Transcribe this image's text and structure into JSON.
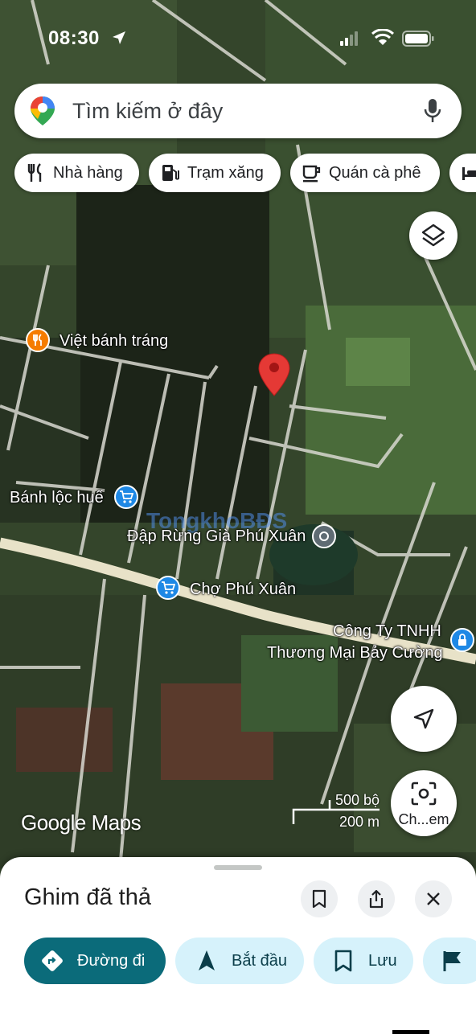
{
  "status_bar": {
    "time": "08:30"
  },
  "search": {
    "placeholder": "Tìm kiếm ở đây"
  },
  "chips": [
    {
      "label": "Nhà hàng",
      "icon": "restaurant-icon"
    },
    {
      "label": "Trạm xăng",
      "icon": "gas-station-icon"
    },
    {
      "label": "Quán cà phê",
      "icon": "coffee-icon"
    },
    {
      "label": "",
      "icon": "hotel-icon"
    }
  ],
  "map": {
    "places": {
      "viet_banh_trang": "Việt bánh tráng",
      "banh_loc_hue": "Bánh lộc huế",
      "dap_rung_gia": "Đập Rừng Già Phú Xuân",
      "cho_phu_xuan": "Chợ Phú Xuân",
      "cong_ty_line1": "Công Ty TNHH",
      "cong_ty_line2": "Thương Mại Bảy Cường"
    },
    "watermark": "TongkhoBĐS",
    "attribution": "Google Maps",
    "scale": {
      "imperial": "500 bộ",
      "metric": "200 m"
    },
    "lens_label": "Ch...em",
    "colors": {
      "pin": "#e53935",
      "poi_orange": "#f57c00",
      "poi_blue": "#1e88e5",
      "road": "#e8e2c8"
    }
  },
  "sheet": {
    "title": "Ghim đã thả",
    "actions": [
      {
        "label": "Đường đi",
        "icon": "directions-icon"
      },
      {
        "label": "Bắt đầu",
        "icon": "navigation-arrow-icon"
      },
      {
        "label": "Lưu",
        "icon": "bookmark-icon"
      },
      {
        "label": "",
        "icon": "flag-icon"
      }
    ],
    "accent": "#0b6b7a"
  }
}
